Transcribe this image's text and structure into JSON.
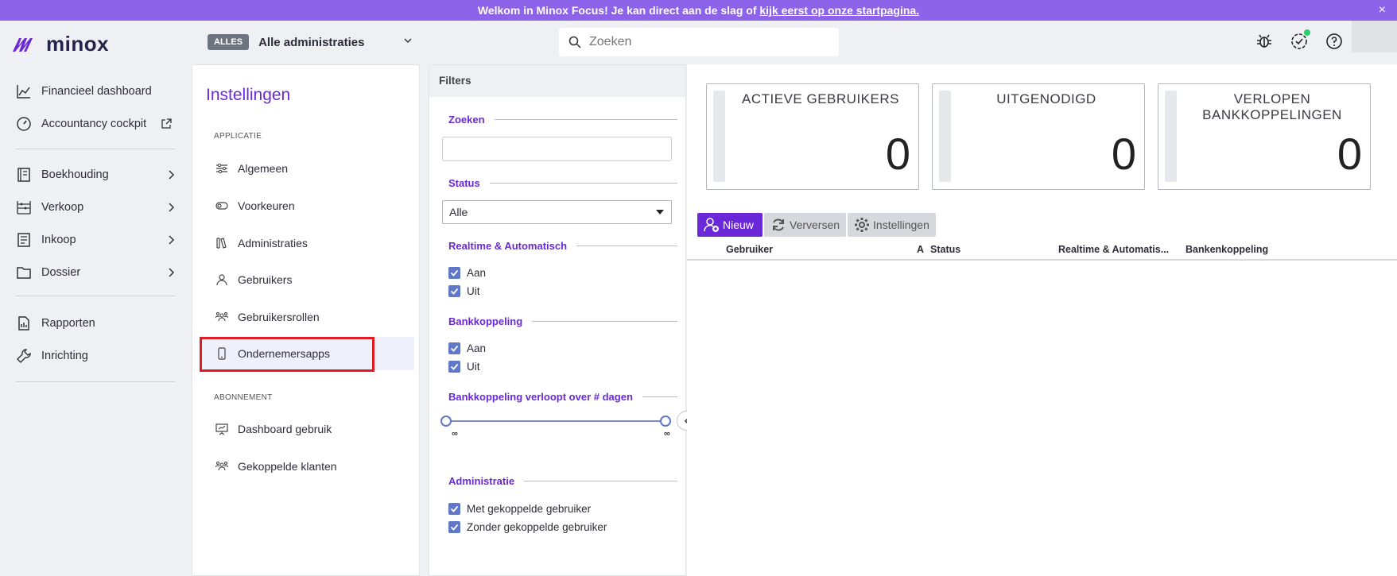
{
  "banner": {
    "text": "Welkom in Minox Focus! Je kan direct aan de slag of ",
    "link": "kijk eerst op onze startpagina.",
    "close": "×"
  },
  "header": {
    "logo_text": "minox",
    "admin_badge": "ALLES",
    "admin_name": "Alle administraties",
    "search_placeholder": "Zoeken"
  },
  "sidebar": {
    "items": [
      {
        "label": "Financieel dashboard",
        "icon": "chart-icon"
      },
      {
        "label": "Accountancy cockpit",
        "icon": "gauge-icon"
      },
      {
        "label": "Boekhouding",
        "icon": "ledger-icon"
      },
      {
        "label": "Verkoop",
        "icon": "abacus-icon"
      },
      {
        "label": "Inkoop",
        "icon": "receipt-icon"
      },
      {
        "label": "Dossier",
        "icon": "folder-icon"
      },
      {
        "label": "Rapporten",
        "icon": "report-icon"
      },
      {
        "label": "Inrichting",
        "icon": "wrench-icon"
      }
    ]
  },
  "settings": {
    "title": "Instellingen",
    "section_app": "APPLICATIE",
    "section_sub": "ABONNEMENT",
    "app_items": [
      {
        "label": "Algemeen"
      },
      {
        "label": "Voorkeuren"
      },
      {
        "label": "Administraties"
      },
      {
        "label": "Gebruikers"
      },
      {
        "label": "Gebruikersrollen"
      },
      {
        "label": "Ondernemersapps"
      }
    ],
    "sub_items": [
      {
        "label": "Dashboard gebruik"
      },
      {
        "label": "Gekoppelde klanten"
      }
    ]
  },
  "filters": {
    "header": "Filters",
    "search_label": "Zoeken",
    "status_label": "Status",
    "status_value": "Alle",
    "realtime_label": "Realtime & Automatisch",
    "realtime_on": "Aan",
    "realtime_off": "Uit",
    "bank_label": "Bankkoppeling",
    "bank_on": "Aan",
    "bank_off": "Uit",
    "expire_label": "Bankkoppeling verloopt over # dagen",
    "slider_min": "∞",
    "slider_max": "∞",
    "admin_label": "Administratie",
    "admin_with": "Met gekoppelde gebruiker",
    "admin_without": "Zonder gekoppelde gebruiker"
  },
  "stats": [
    {
      "title": "ACTIEVE GEBRUIKERS",
      "value": "0"
    },
    {
      "title": "UITGENODIGD",
      "value": "0"
    },
    {
      "title": "VERLOPEN BANKKOPPELINGEN",
      "value": "0"
    }
  ],
  "toolbar": {
    "new": "Nieuw",
    "refresh": "Verversen",
    "settings": "Instellingen"
  },
  "table": {
    "columns": [
      "Gebruiker",
      "A",
      "Status",
      "Realtime & Automatis...",
      "Bankenkoppeling"
    ]
  },
  "colors": {
    "accent": "#6a28d9",
    "banner": "#8c63e9",
    "checkbox": "#6177c7"
  }
}
